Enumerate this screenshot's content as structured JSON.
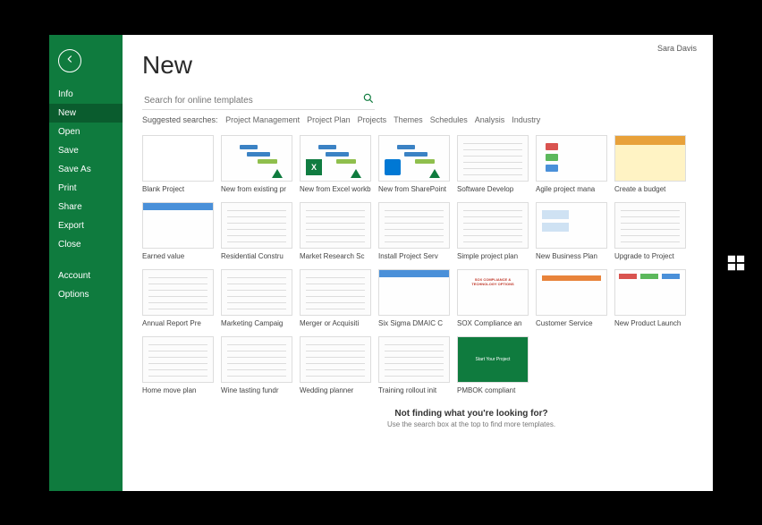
{
  "user": {
    "name": "Sara Davis"
  },
  "sidebar": {
    "items": [
      {
        "label": "Info"
      },
      {
        "label": "New"
      },
      {
        "label": "Open"
      },
      {
        "label": "Save"
      },
      {
        "label": "Save As"
      },
      {
        "label": "Print"
      },
      {
        "label": "Share"
      },
      {
        "label": "Export"
      },
      {
        "label": "Close"
      }
    ],
    "secondary": [
      {
        "label": "Account"
      },
      {
        "label": "Options"
      }
    ]
  },
  "page": {
    "title": "New",
    "search_placeholder": "Search for online templates",
    "suggested_label": "Suggested searches:",
    "suggested": [
      "Project Management",
      "Project Plan",
      "Projects",
      "Themes",
      "Schedules",
      "Analysis",
      "Industry"
    ]
  },
  "templates": [
    {
      "label": "Blank Project",
      "variant": "t-blank"
    },
    {
      "label": "New from existing pr",
      "variant": "t-gantt"
    },
    {
      "label": "New from Excel workb",
      "variant": "t-gantt t-excel"
    },
    {
      "label": "New from SharePoint",
      "variant": "t-gantt t-sp"
    },
    {
      "label": "Software Develop",
      "variant": "t-doc"
    },
    {
      "label": "Agile project mana",
      "variant": "t-agile"
    },
    {
      "label": "Create a budget",
      "variant": "t-budget"
    },
    {
      "label": "Earned value",
      "variant": "t-blue"
    },
    {
      "label": "Residential Constru",
      "variant": "t-doc"
    },
    {
      "label": "Market Research Sc",
      "variant": "t-doc"
    },
    {
      "label": "Install Project Serv",
      "variant": "t-doc"
    },
    {
      "label": "Simple project plan",
      "variant": "t-doc"
    },
    {
      "label": "New Business Plan",
      "variant": "t-blue2"
    },
    {
      "label": "Upgrade to Project",
      "variant": "t-doc"
    },
    {
      "label": "Annual Report Pre",
      "variant": "t-doc"
    },
    {
      "label": "Marketing Campaig",
      "variant": "t-doc"
    },
    {
      "label": "Merger or Acquisiti",
      "variant": "t-doc"
    },
    {
      "label": "Six Sigma DMAIC C",
      "variant": "t-blue"
    },
    {
      "label": "SOX Compliance an",
      "variant": "t-sox"
    },
    {
      "label": "Customer Service",
      "variant": "t-orange"
    },
    {
      "label": "New Product Launch",
      "variant": "t-colorful"
    },
    {
      "label": "Home move plan",
      "variant": "t-doc"
    },
    {
      "label": "Wine tasting fundr",
      "variant": "t-doc"
    },
    {
      "label": "Wedding planner",
      "variant": "t-doc"
    },
    {
      "label": "Training rollout init",
      "variant": "t-doc"
    },
    {
      "label": "PMBOK compliant",
      "variant": "t-pmbok"
    }
  ],
  "footer": {
    "line1": "Not finding what you're looking for?",
    "line2": "Use the search box at the top to find more templates."
  }
}
